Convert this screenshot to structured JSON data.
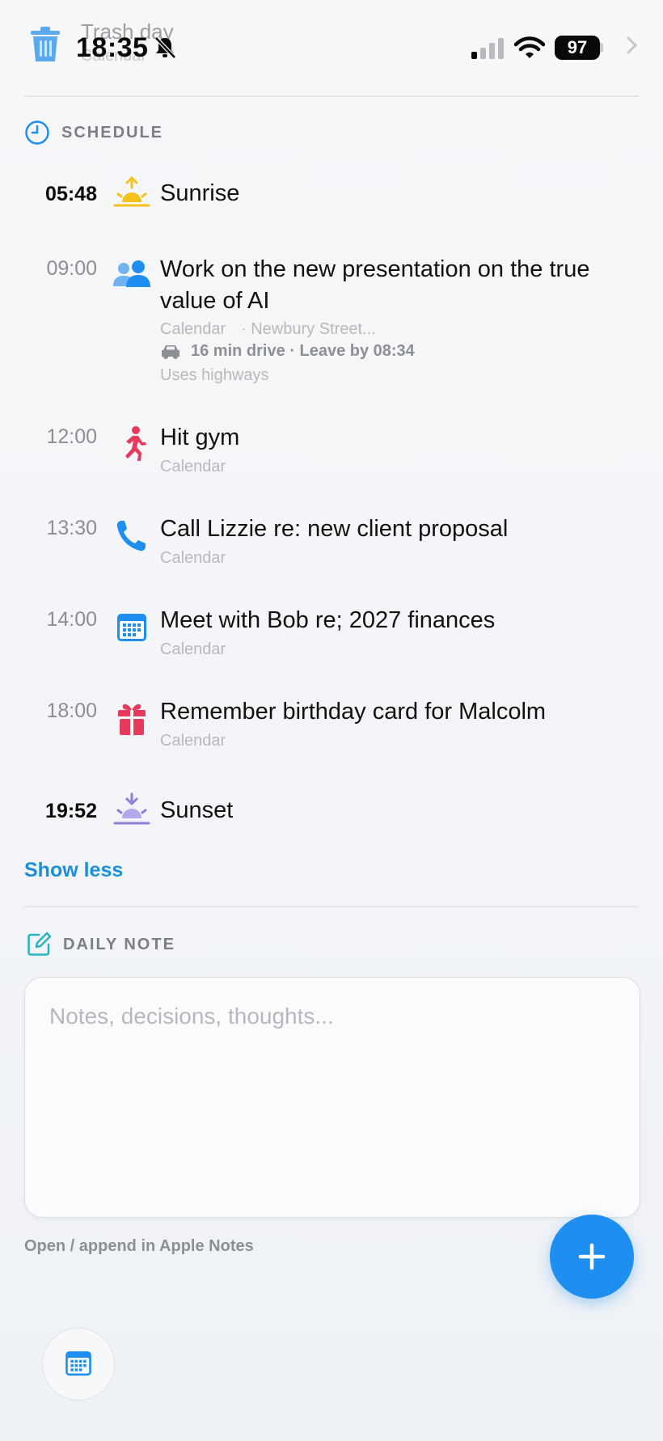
{
  "status_bar": {
    "time": "18:35",
    "battery": "97",
    "behind_title": "Trash day",
    "behind_subtitle": "Calendar"
  },
  "schedule": {
    "label": "SCHEDULE",
    "items": [
      {
        "time": "05:48",
        "title": "Sunrise",
        "icon": "sunrise-icon"
      },
      {
        "time": "09:00",
        "title": "Work on the new presentation on the true value of AI",
        "source": "Calendar",
        "location": "· Newbury Street...",
        "drive": "16 min drive · Leave by 08:34",
        "note": "Uses highways",
        "icon": "people-icon"
      },
      {
        "time": "12:00",
        "title": "Hit gym",
        "source": "Calendar",
        "icon": "running-icon"
      },
      {
        "time": "13:30",
        "title": "Call Lizzie re: new client proposal",
        "source": "Calendar",
        "icon": "phone-icon"
      },
      {
        "time": "14:00",
        "title": "Meet with Bob re; 2027 finances",
        "source": "Calendar",
        "icon": "calendar-icon"
      },
      {
        "time": "18:00",
        "title": "Remember birthday card for Malcolm",
        "source": "Calendar",
        "icon": "gift-icon"
      },
      {
        "time": "19:52",
        "title": "Sunset",
        "icon": "sunset-icon"
      }
    ],
    "show_less": "Show less"
  },
  "daily_note": {
    "label": "DAILY NOTE",
    "placeholder": "Notes, decisions, thoughts...",
    "open_link": "Open / append in Apple Notes"
  },
  "colors": {
    "accent": "#1e8ff0",
    "link": "#1d8fd8",
    "sun": "#f5c21b",
    "sunset": "#8e7fd8",
    "gym": "#e63a5c",
    "gift": "#e63a5c",
    "note_icon": "#2ab3c0"
  }
}
